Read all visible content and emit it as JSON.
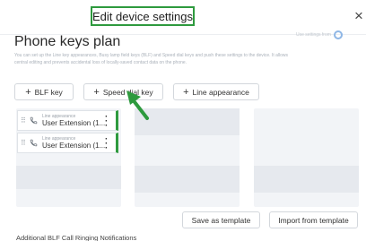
{
  "dialog": {
    "title": "Edit device settings",
    "close": "×"
  },
  "plan": {
    "title": "Phone keys plan",
    "description": "You can set up the Line key appearances, Busy lamp field keys (BLF) and Speed dial keys and push these settings to the device. It allows central editing and prevents accidental loss of locally-saved contact data on the phone.",
    "toggle_label": "Use settings from"
  },
  "toolbar": {
    "blf_label": "BLF key",
    "speed_dial_label": "Speed dial key",
    "line_appearance_label": "Line appearance"
  },
  "keys": [
    {
      "type": "Line appearance",
      "name": "User Extension (1..."
    },
    {
      "type": "Line appearance",
      "name": "User Extension (1..."
    }
  ],
  "actions": {
    "save_template_label": "Save as template",
    "import_template_label": "Import from template"
  },
  "footer": {
    "section_title": "Additional BLF Call Ringing Notifications"
  },
  "colors": {
    "highlight": "#2e9a3e",
    "accent": "#2f80ed"
  }
}
